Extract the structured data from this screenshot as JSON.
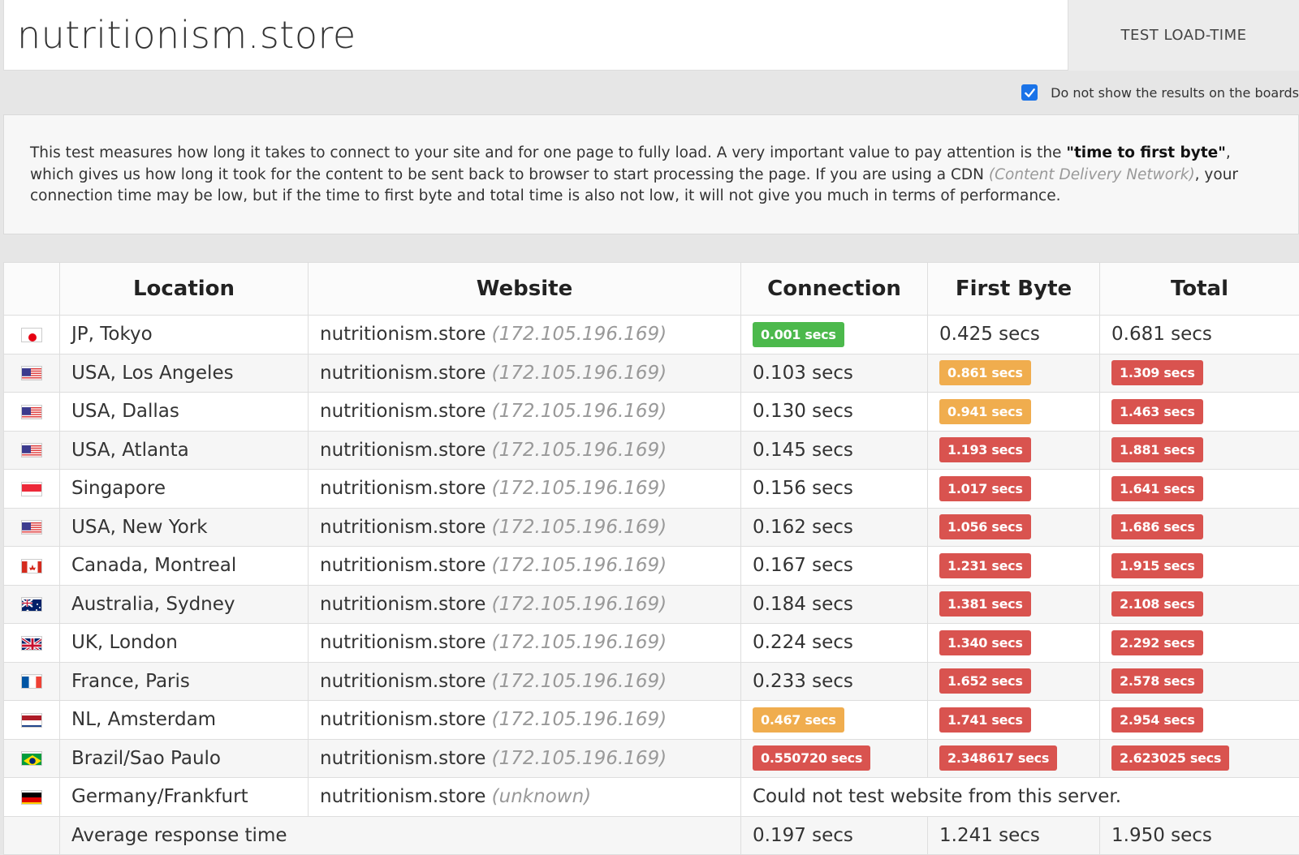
{
  "search": {
    "value": "nutritionism.store",
    "button_label": "TEST LOAD-TIME"
  },
  "option": {
    "checked": true,
    "label": "Do not show the results on the boards"
  },
  "info": {
    "part1": "This test measures how long it takes to connect to your site and for one page to fully load. A very important value to pay attention is the ",
    "bold": "\"time to first byte\"",
    "part2": ", which gives us how long it took for the content to be sent back to browser to start processing the page. If you are using a CDN ",
    "italic": "(Content Delivery Network)",
    "part3": ", your connection time may be low, but if the time to first byte and total time is also not low, it will not give you much in terms of performance."
  },
  "table": {
    "headers": {
      "location": "Location",
      "website": "Website",
      "connection": "Connection",
      "first_byte": "First Byte",
      "total": "Total"
    },
    "rows": [
      {
        "flag": "jp",
        "location": "JP, Tokyo",
        "site": "nutritionism.store",
        "ip": "(172.105.196.169)",
        "connection": {
          "text": "0.001 secs",
          "status": "green"
        },
        "first_byte": {
          "text": "0.425 secs",
          "status": "none"
        },
        "total": {
          "text": "0.681 secs",
          "status": "none"
        }
      },
      {
        "flag": "us",
        "location": "USA, Los Angeles",
        "site": "nutritionism.store",
        "ip": "(172.105.196.169)",
        "connection": {
          "text": "0.103 secs",
          "status": "none"
        },
        "first_byte": {
          "text": "0.861 secs",
          "status": "orange"
        },
        "total": {
          "text": "1.309 secs",
          "status": "red"
        }
      },
      {
        "flag": "us",
        "location": "USA, Dallas",
        "site": "nutritionism.store",
        "ip": "(172.105.196.169)",
        "connection": {
          "text": "0.130 secs",
          "status": "none"
        },
        "first_byte": {
          "text": "0.941 secs",
          "status": "orange"
        },
        "total": {
          "text": "1.463 secs",
          "status": "red"
        }
      },
      {
        "flag": "us",
        "location": "USA, Atlanta",
        "site": "nutritionism.store",
        "ip": "(172.105.196.169)",
        "connection": {
          "text": "0.145 secs",
          "status": "none"
        },
        "first_byte": {
          "text": "1.193 secs",
          "status": "red"
        },
        "total": {
          "text": "1.881 secs",
          "status": "red"
        }
      },
      {
        "flag": "sg",
        "location": "Singapore",
        "site": "nutritionism.store",
        "ip": "(172.105.196.169)",
        "connection": {
          "text": "0.156 secs",
          "status": "none"
        },
        "first_byte": {
          "text": "1.017 secs",
          "status": "red"
        },
        "total": {
          "text": "1.641 secs",
          "status": "red"
        }
      },
      {
        "flag": "us",
        "location": "USA, New York",
        "site": "nutritionism.store",
        "ip": "(172.105.196.169)",
        "connection": {
          "text": "0.162 secs",
          "status": "none"
        },
        "first_byte": {
          "text": "1.056 secs",
          "status": "red"
        },
        "total": {
          "text": "1.686 secs",
          "status": "red"
        }
      },
      {
        "flag": "ca",
        "location": "Canada, Montreal",
        "site": "nutritionism.store",
        "ip": "(172.105.196.169)",
        "connection": {
          "text": "0.167 secs",
          "status": "none"
        },
        "first_byte": {
          "text": "1.231 secs",
          "status": "red"
        },
        "total": {
          "text": "1.915 secs",
          "status": "red"
        }
      },
      {
        "flag": "au",
        "location": "Australia, Sydney",
        "site": "nutritionism.store",
        "ip": "(172.105.196.169)",
        "connection": {
          "text": "0.184 secs",
          "status": "none"
        },
        "first_byte": {
          "text": "1.381 secs",
          "status": "red"
        },
        "total": {
          "text": "2.108 secs",
          "status": "red"
        }
      },
      {
        "flag": "uk",
        "location": "UK, London",
        "site": "nutritionism.store",
        "ip": "(172.105.196.169)",
        "connection": {
          "text": "0.224 secs",
          "status": "none"
        },
        "first_byte": {
          "text": "1.340 secs",
          "status": "red"
        },
        "total": {
          "text": "2.292 secs",
          "status": "red"
        }
      },
      {
        "flag": "fr",
        "location": "France, Paris",
        "site": "nutritionism.store",
        "ip": "(172.105.196.169)",
        "connection": {
          "text": "0.233 secs",
          "status": "none"
        },
        "first_byte": {
          "text": "1.652 secs",
          "status": "red"
        },
        "total": {
          "text": "2.578 secs",
          "status": "red"
        }
      },
      {
        "flag": "nl",
        "location": "NL, Amsterdam",
        "site": "nutritionism.store",
        "ip": "(172.105.196.169)",
        "connection": {
          "text": "0.467 secs",
          "status": "orange"
        },
        "first_byte": {
          "text": "1.741 secs",
          "status": "red"
        },
        "total": {
          "text": "2.954 secs",
          "status": "red"
        }
      },
      {
        "flag": "br",
        "location": "Brazil/Sao Paulo",
        "site": "nutritionism.store",
        "ip": "(172.105.196.169)",
        "connection": {
          "text": "0.550720 secs",
          "status": "red"
        },
        "first_byte": {
          "text": "2.348617 secs",
          "status": "red"
        },
        "total": {
          "text": "2.623025 secs",
          "status": "red"
        }
      }
    ],
    "error_row": {
      "flag": "de",
      "location": "Germany/Frankfurt",
      "site": "nutritionism.store",
      "ip": "(unknown)",
      "message": "Could not test website from this server."
    },
    "average": {
      "label": "Average response time",
      "connection": "0.197 secs",
      "first_byte": "1.241 secs",
      "total": "1.950 secs"
    }
  }
}
